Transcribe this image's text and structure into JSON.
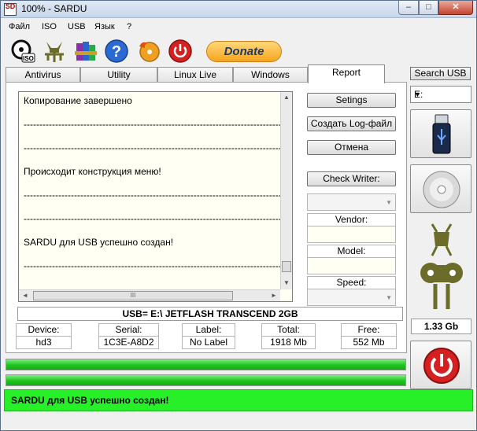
{
  "window": {
    "title": "100%  -  SARDU",
    "min_glyph": "–",
    "max_glyph": "□",
    "close_glyph": "✕",
    "icon_text": "SD"
  },
  "menu": [
    "Файл",
    "ISO",
    "USB",
    "Язык",
    "?"
  ],
  "toolbar": {
    "icons": [
      "iso-disc-icon",
      "sardu-robot-icon",
      "winrar-books-icon",
      "help-icon",
      "disc-burn-icon",
      "power-icon"
    ],
    "iso_label": "ISO",
    "help_glyph": "?",
    "donate_label": "Donate"
  },
  "tabs": [
    "Antivirus",
    "Utility",
    "Linux Live",
    "Windows",
    "Report"
  ],
  "active_tab": "Report",
  "log": {
    "lines": [
      "Копирование завершено",
      "-----------------------------------------------------------------------------------",
      "-----------------------------------------------------------------------------------",
      "Происходит конструкция меню!",
      "-----------------------------------------------------------------------------------",
      "-----------------------------------------------------------------------------------",
      "SARDU для USB успешно создан!",
      "-----------------------------------------------------------------------------------"
    ],
    "scroll_up": "▲",
    "scroll_down": "▼",
    "scroll_left": "◄",
    "scroll_right": "►",
    "grip": "III"
  },
  "buttons": {
    "settings": "Setings",
    "create_log": "Создать Log-файл",
    "cancel": "Отмена",
    "check_writer": "Check Writer:"
  },
  "writer": {
    "combo_arrow": "▼",
    "vendor_label": "Vendor:",
    "vendor_value": "",
    "model_label": "Model:",
    "model_value": "",
    "speed_label": "Speed:",
    "speed_arrow": "▼"
  },
  "usb_line": "USB= E:\\ JETFLASH TRANSCEND 2GB",
  "device_info": [
    {
      "label": "Device:",
      "value": "hd3"
    },
    {
      "label": "Serial:",
      "value": "1C3E-A8D2"
    },
    {
      "label": "Label:",
      "value": "No Label"
    },
    {
      "label": "Total:",
      "value": "1918 Mb"
    },
    {
      "label": "Free:",
      "value": "552 Mb"
    }
  ],
  "right": {
    "search_usb": "Search USB",
    "drive": "E:",
    "drive_arrow": "▼",
    "size": "1.33 Gb"
  },
  "progress": [
    1.0,
    1.0
  ],
  "status": "SARDU для USB успешно создан!",
  "colors": {
    "status_green": "#28f028",
    "progress_green": "#21c421",
    "power_red": "#d42020",
    "sardu_olive": "#6b6b2a"
  }
}
